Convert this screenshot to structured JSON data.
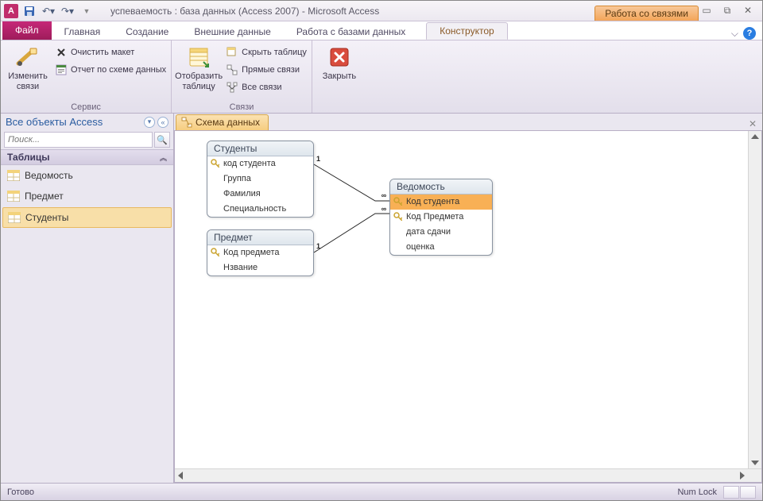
{
  "window": {
    "title": "успеваемость : база данных (Access 2007)  -  Microsoft Access",
    "context_tab_group": "Работа со связями"
  },
  "tabs": {
    "file": "Файл",
    "home": "Главная",
    "create": "Создание",
    "external": "Внешние данные",
    "dbtools": "Работа с базами данных",
    "design": "Конструктор"
  },
  "ribbon": {
    "group_service": "Сервис",
    "group_relations": "Связи",
    "edit_relations": "Изменить связи",
    "clear_layout": "Очистить макет",
    "schema_report": "Отчет по схеме данных",
    "show_table": "Отобразить таблицу",
    "hide_table": "Скрыть таблицу",
    "direct_relations": "Прямые связи",
    "all_relations": "Все связи",
    "close": "Закрыть"
  },
  "nav": {
    "header": "Все объекты Access",
    "search_placeholder": "Поиск...",
    "section_tables": "Таблицы",
    "items": [
      "Ведомость",
      "Предмет",
      "Студенты"
    ]
  },
  "doc": {
    "tab": "Схема данных"
  },
  "tables": {
    "students": {
      "title": "Студенты",
      "fields": [
        "код студента",
        "Группа",
        "Фамилия",
        "Специальность"
      ]
    },
    "subject": {
      "title": "Предмет",
      "fields": [
        "Код предмета",
        "Нзвание"
      ]
    },
    "ledger": {
      "title": "Ведомость",
      "fields": [
        "Код студента",
        "Код Предмета",
        "дата сдачи",
        "оценка"
      ]
    }
  },
  "chart_data": {
    "type": "table",
    "diagram": "relationships",
    "tables": [
      {
        "name": "Студенты",
        "pk": [
          "код студента"
        ],
        "fields": [
          "код студента",
          "Группа",
          "Фамилия",
          "Специальность"
        ]
      },
      {
        "name": "Предмет",
        "pk": [
          "Код предмета"
        ],
        "fields": [
          "Код предмета",
          "Нзвание"
        ]
      },
      {
        "name": "Ведомость",
        "pk": [
          "Код студента",
          "Код Предмета"
        ],
        "fields": [
          "Код студента",
          "Код Предмета",
          "дата сдачи",
          "оценка"
        ]
      }
    ],
    "relations": [
      {
        "from_table": "Студенты",
        "from_field": "код студента",
        "to_table": "Ведомость",
        "to_field": "Код студента",
        "cardinality": "1:∞"
      },
      {
        "from_table": "Предмет",
        "from_field": "Код предмета",
        "to_table": "Ведомость",
        "to_field": "Код Предмета",
        "cardinality": "1:∞"
      }
    ]
  },
  "status": {
    "ready": "Готово",
    "numlock": "Num Lock"
  }
}
